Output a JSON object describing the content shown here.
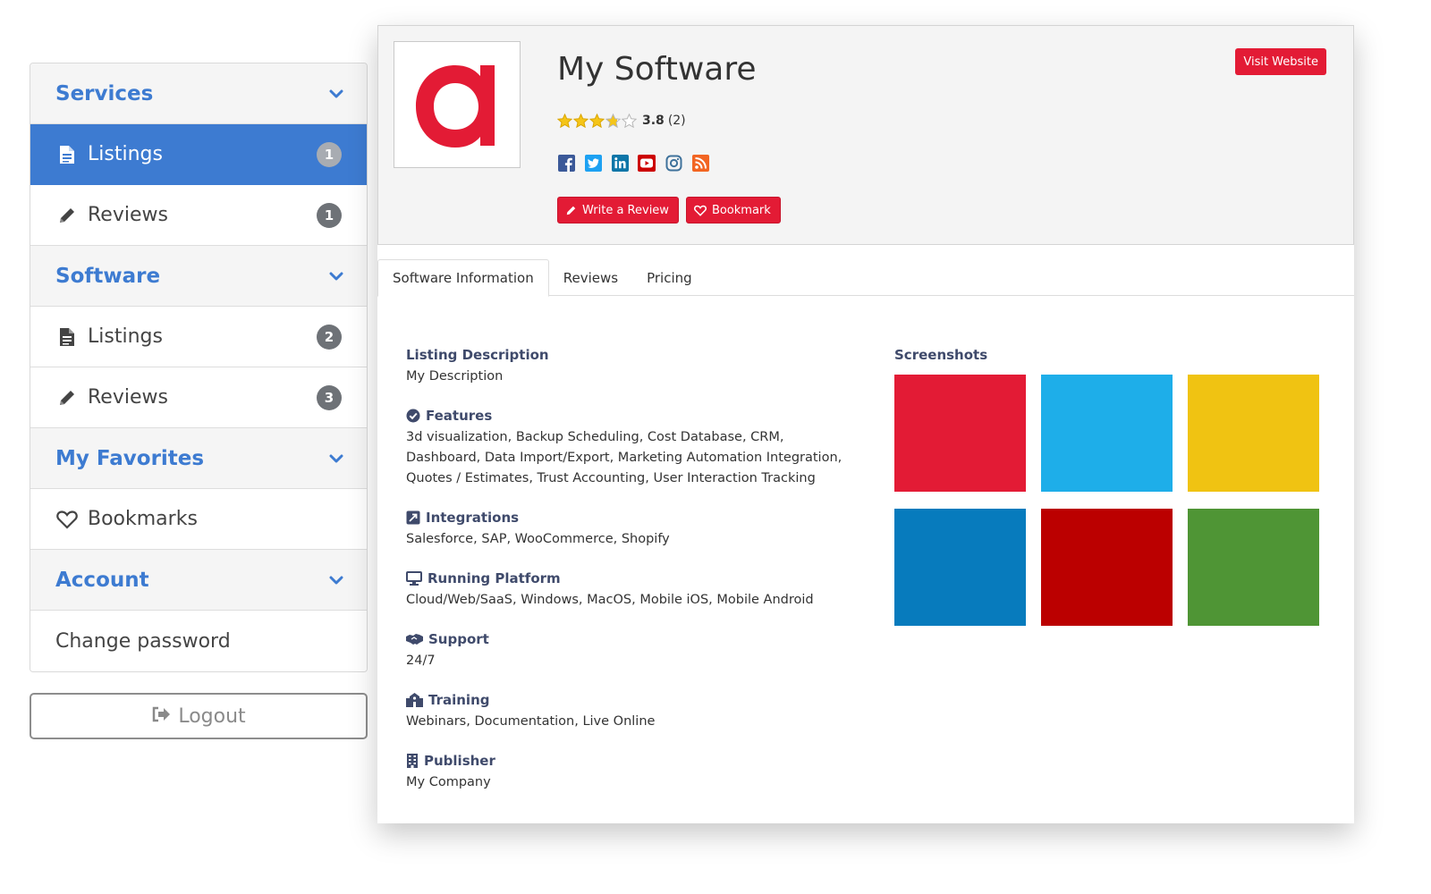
{
  "sidebar": {
    "services": {
      "heading": "Services",
      "items": [
        {
          "label": "Listings",
          "count": "1"
        },
        {
          "label": "Reviews",
          "count": "1"
        }
      ]
    },
    "software": {
      "heading": "Software",
      "items": [
        {
          "label": "Listings",
          "count": "2"
        },
        {
          "label": "Reviews",
          "count": "3"
        }
      ]
    },
    "favorites": {
      "heading": "My Favorites",
      "items": [
        {
          "label": "Bookmarks"
        }
      ]
    },
    "account": {
      "heading": "Account",
      "items": [
        {
          "label": "Change password"
        }
      ]
    },
    "logout_label": "Logout"
  },
  "product": {
    "title": "My Software",
    "rating": {
      "score": "3.8",
      "count": "(2)",
      "value": 3.8,
      "max": 5
    },
    "visit_label": "Visit Website",
    "write_review_label": "Write a Review",
    "bookmark_label": "Bookmark",
    "socials": [
      "facebook-icon",
      "twitter-icon",
      "linkedin-icon",
      "youtube-icon",
      "instagram-icon",
      "rss-icon"
    ]
  },
  "tabs": [
    "Software Information",
    "Reviews",
    "Pricing"
  ],
  "info": {
    "description": {
      "title": "Listing Description",
      "text": "My Description"
    },
    "features": {
      "title": "Features",
      "text": "3d visualization, Backup Scheduling, Cost Database, CRM, Dashboard, Data Import/Export, Marketing Automation Integration, Quotes / Estimates, Trust Accounting, User Interaction Tracking"
    },
    "integrations": {
      "title": "Integrations",
      "text": "Salesforce, SAP, WooCommerce, Shopify"
    },
    "platform": {
      "title": "Running Platform",
      "text": "Cloud/Web/SaaS, Windows, MacOS, Mobile iOS, Mobile Android"
    },
    "support": {
      "title": "Support",
      "text": "24/7"
    },
    "training": {
      "title": "Training",
      "text": "Webinars, Documentation, Live Online"
    },
    "publisher": {
      "title": "Publisher",
      "text": "My Company"
    }
  },
  "screenshots": {
    "title": "Screenshots",
    "colors": [
      "#e31b35",
      "#1eaee9",
      "#f0c312",
      "#077bbd",
      "#bb0000",
      "#4f9535"
    ]
  },
  "colors": {
    "accent": "#3d7bd1",
    "brand_red": "#e31b35",
    "star": "#f5c518"
  }
}
